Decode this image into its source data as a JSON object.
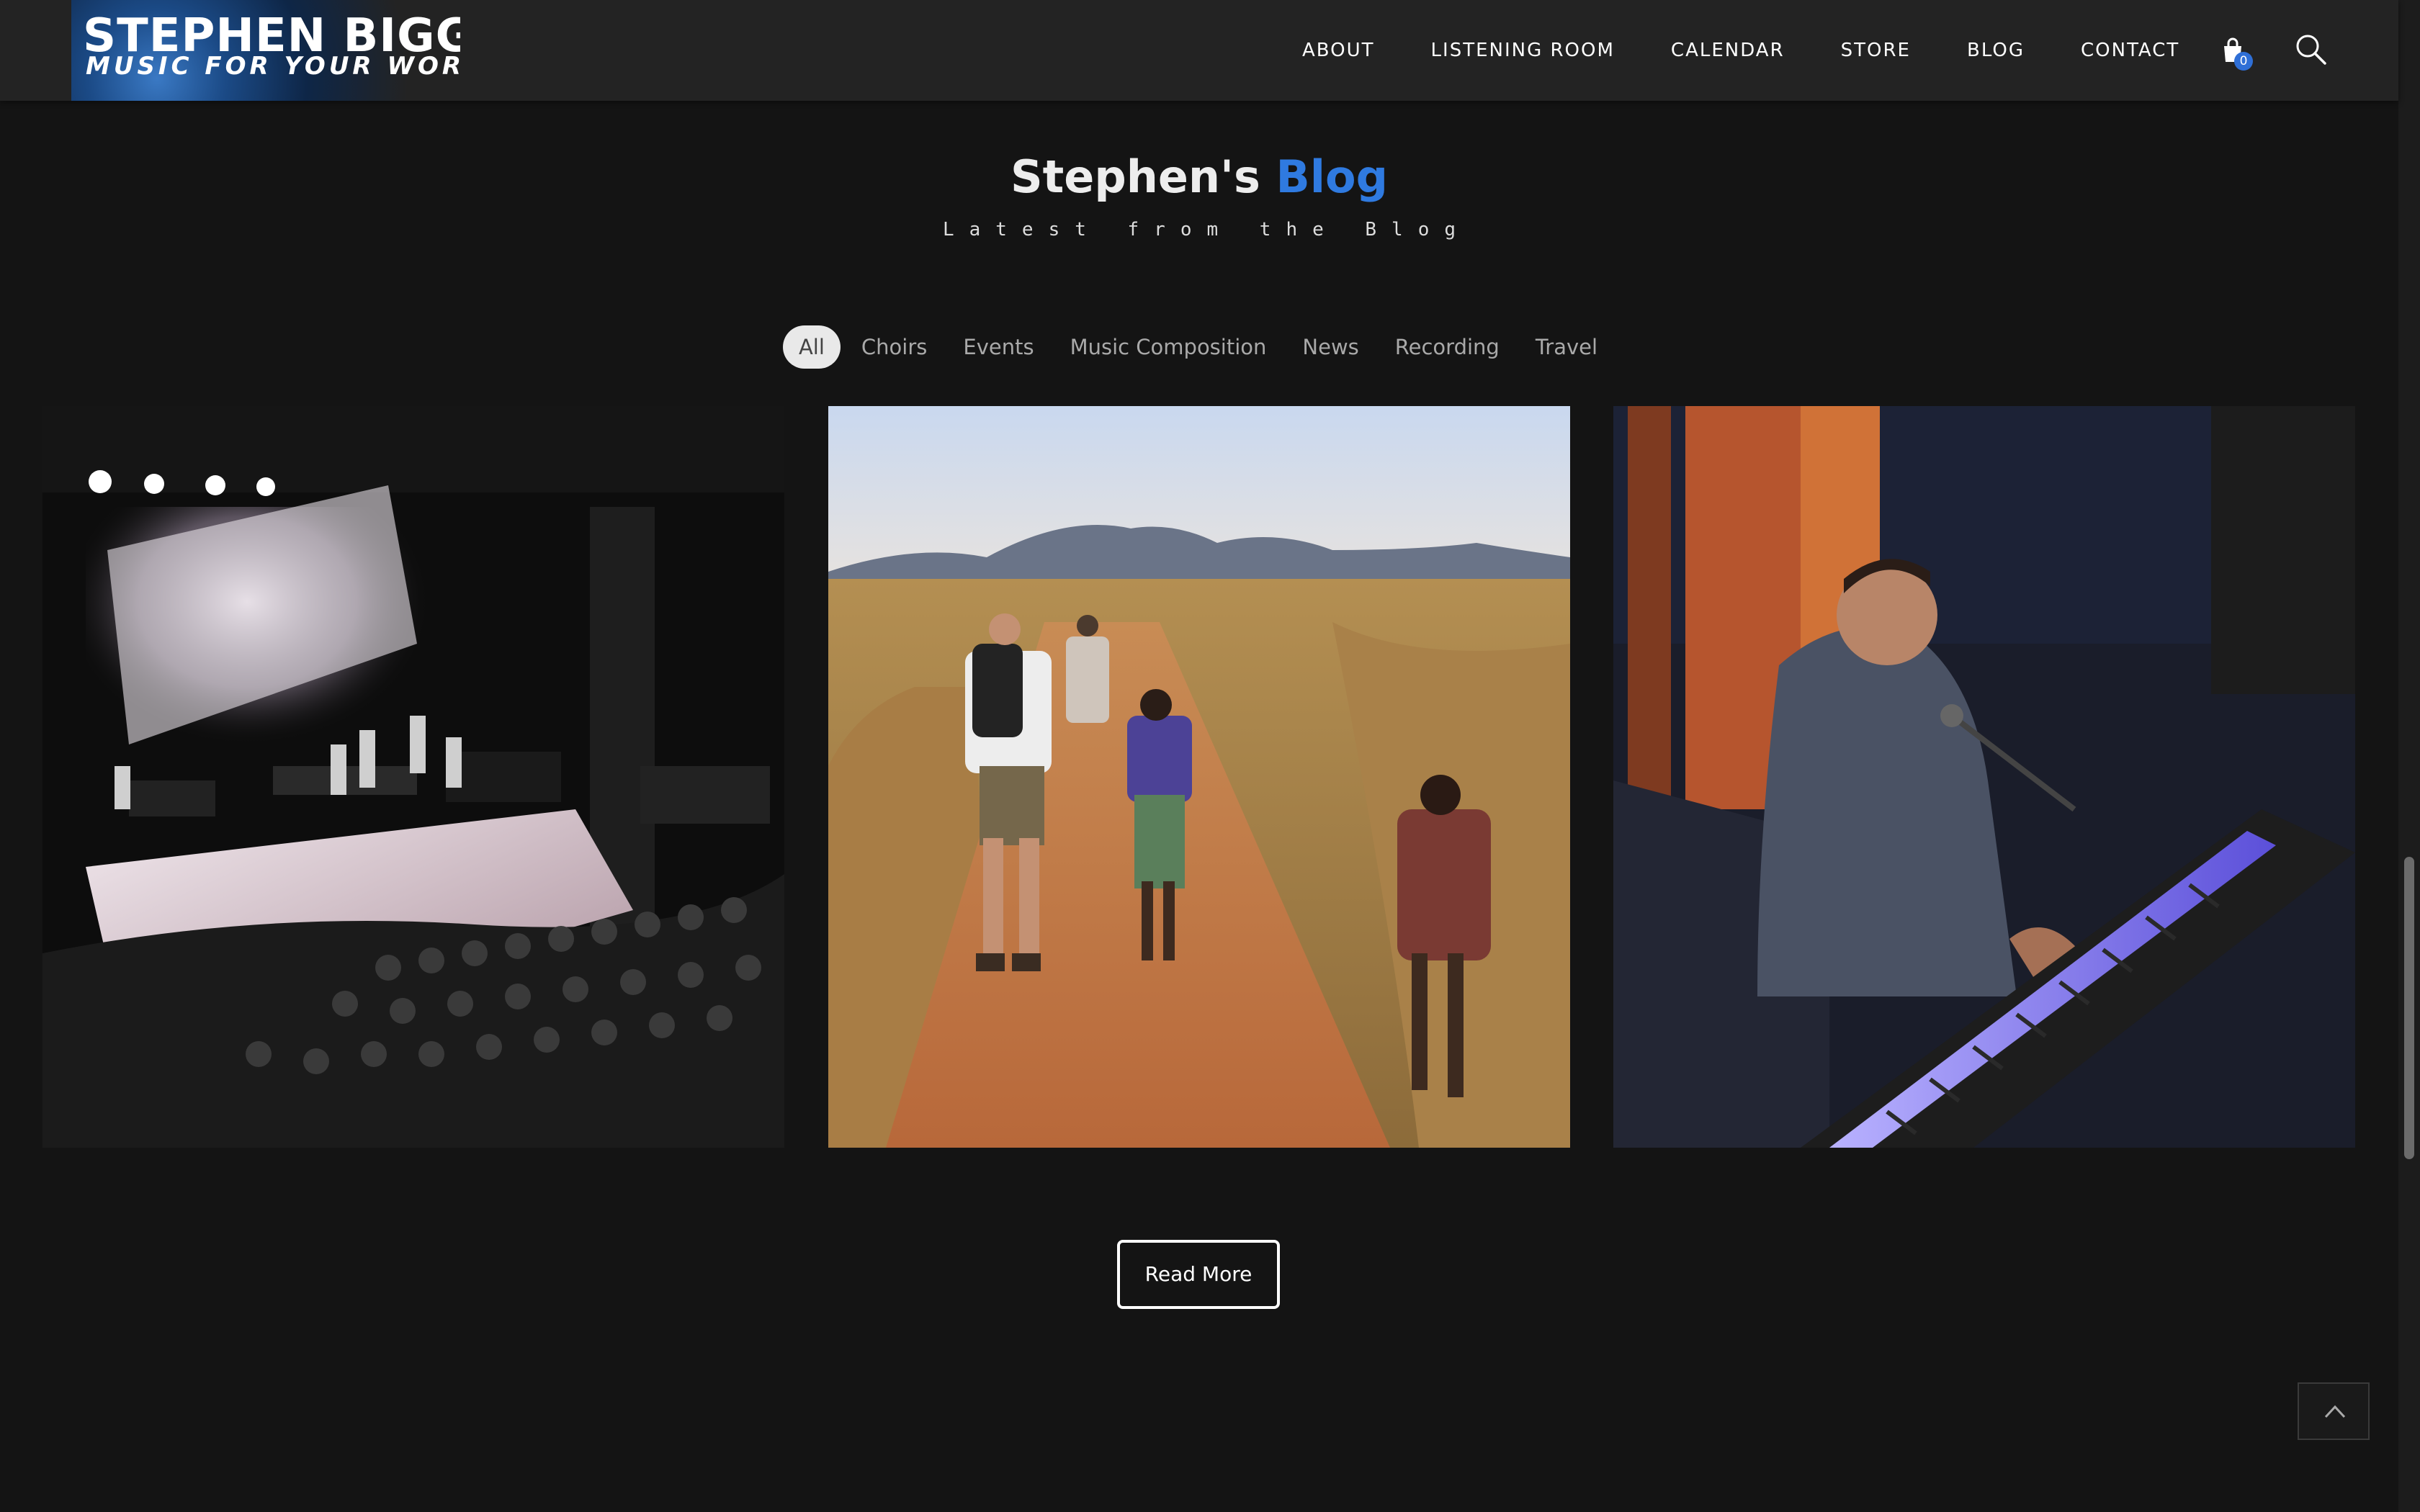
{
  "logo": {
    "line1": "STEPHEN BIGGER",
    "line2": "MUSIC FOR YOUR WORLD"
  },
  "nav": {
    "items": [
      {
        "label": "ABOUT"
      },
      {
        "label": "LISTENING ROOM"
      },
      {
        "label": "CALENDAR"
      },
      {
        "label": "STORE"
      },
      {
        "label": "BLOG"
      },
      {
        "label": "CONTACT"
      }
    ],
    "cart_count": "0",
    "cart_icon": "shopping-bag-icon",
    "search_icon": "search-icon"
  },
  "section": {
    "title_prefix": "Stephen's",
    "title_accent": "Blog",
    "subtitle": "Latest from the Blog",
    "accent_color": "#2f7ae0"
  },
  "filters": {
    "items": [
      {
        "label": "All",
        "active": true
      },
      {
        "label": "Choirs"
      },
      {
        "label": "Events"
      },
      {
        "label": "Music Composition"
      },
      {
        "label": "News"
      },
      {
        "label": "Recording"
      },
      {
        "label": "Travel"
      }
    ]
  },
  "posts": [
    {
      "image": "concert-stage-photo"
    },
    {
      "image": "dirt-path-walking-photo"
    },
    {
      "image": "keyboard-player-photo"
    }
  ],
  "read_more": {
    "label": "Read More"
  },
  "back_to_top": {
    "icon": "chevron-up-icon"
  }
}
